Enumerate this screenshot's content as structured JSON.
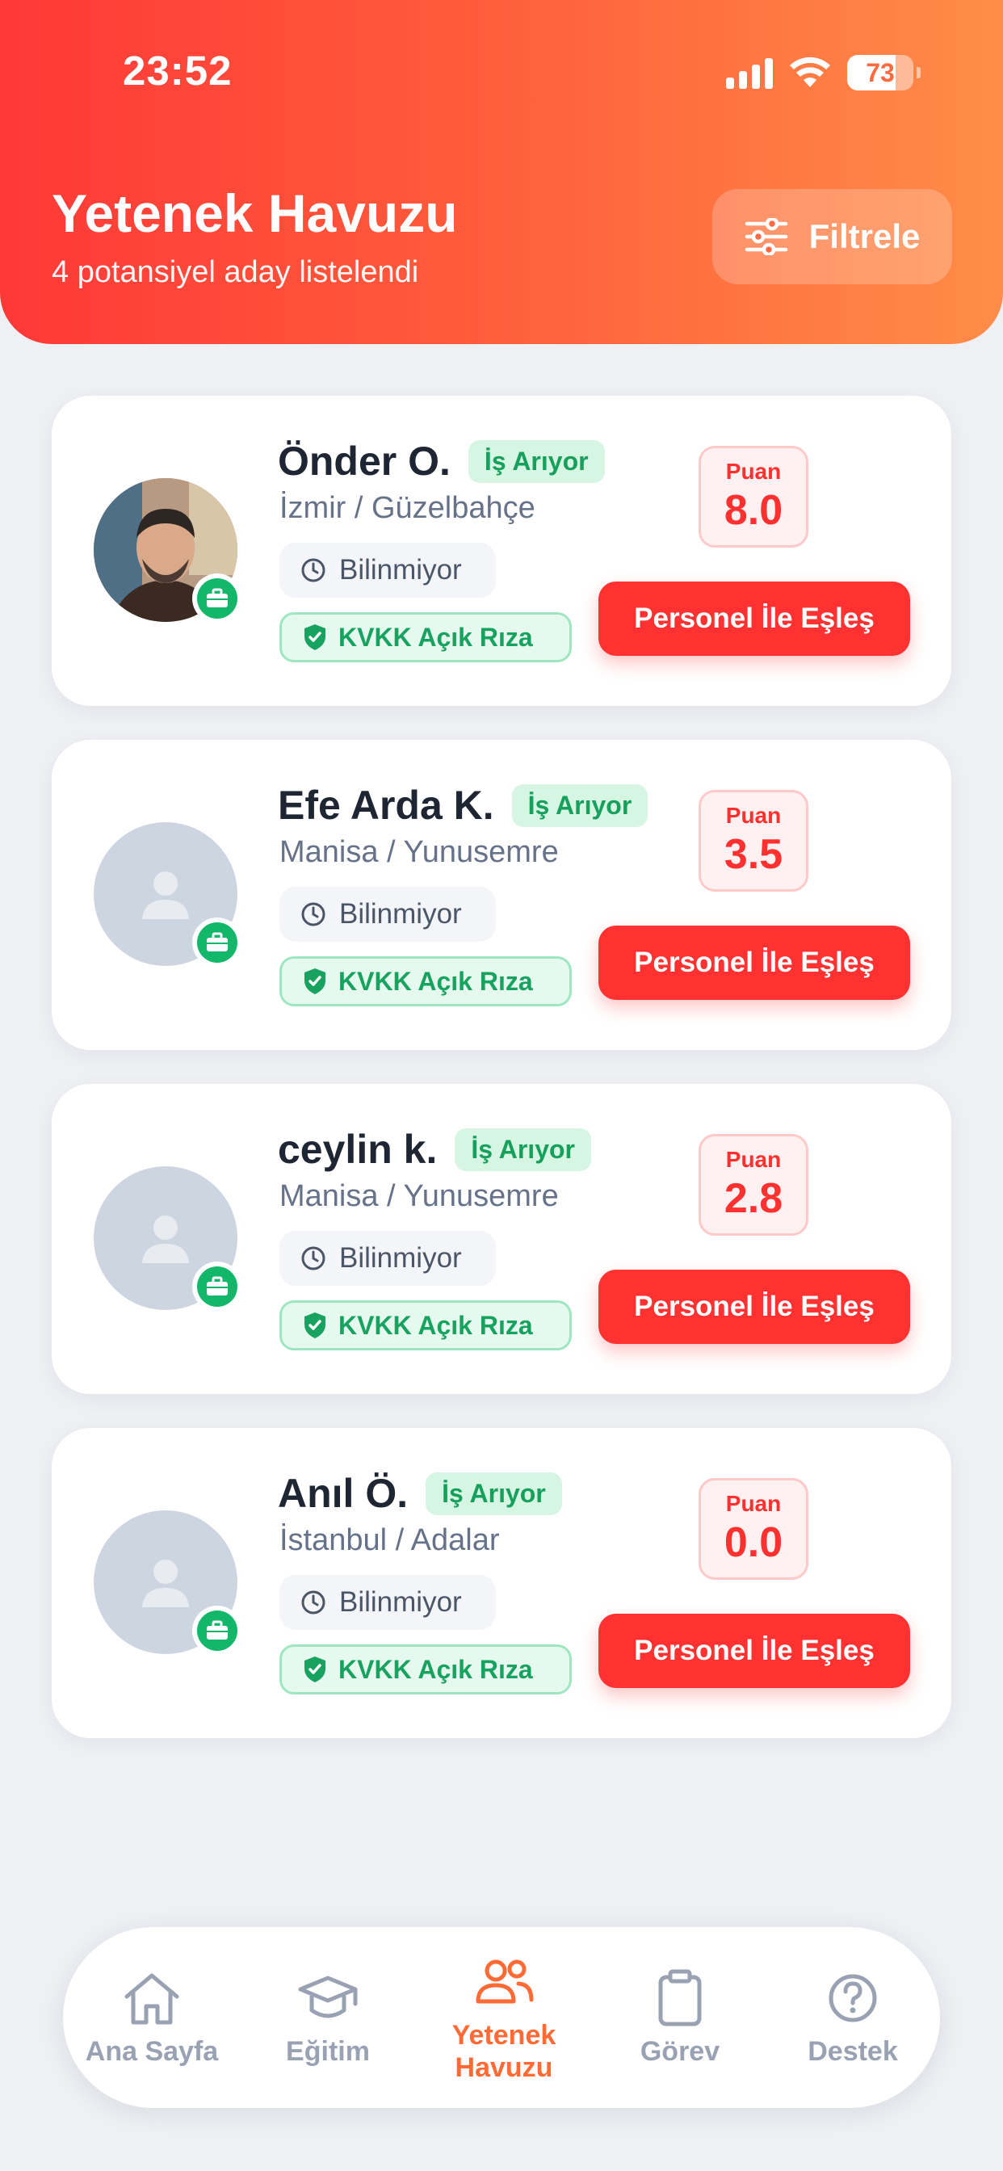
{
  "status_bar": {
    "time": "23:52",
    "battery": "73"
  },
  "header": {
    "title": "Yetenek Havuzu",
    "subtitle": "4 potansiyel aday listelendi",
    "filter_label": "Filtrele"
  },
  "candidates": [
    {
      "name": "Önder O.",
      "status": "İş Arıyor",
      "location": "İzmir / Güzelbahçe",
      "availability": "Bilinmiyor",
      "consent": "KVKK Açık Rıza",
      "score_label": "Puan",
      "score": "8.0",
      "action": "Personel İle Eşleş"
    },
    {
      "name": "Efe Arda K.",
      "status": "İş Arıyor",
      "location": "Manisa / Yunusemre",
      "availability": "Bilinmiyor",
      "consent": "KVKK Açık Rıza",
      "score_label": "Puan",
      "score": "3.5",
      "action": "Personel İle Eşleş"
    },
    {
      "name": "ceylin k.",
      "status": "İş Arıyor",
      "location": "Manisa / Yunusemre",
      "availability": "Bilinmiyor",
      "consent": "KVKK Açık Rıza",
      "score_label": "Puan",
      "score": "2.8",
      "action": "Personel İle Eşleş"
    },
    {
      "name": "Anıl Ö.",
      "status": "İş Arıyor",
      "location": "İstanbul / Adalar",
      "availability": "Bilinmiyor",
      "consent": "KVKK Açık Rıza",
      "score_label": "Puan",
      "score": "0.0",
      "action": "Personel İle Eşleş"
    }
  ],
  "nav": {
    "items": [
      {
        "label": "Ana Sayfa",
        "icon": "home-icon"
      },
      {
        "label": "Eğitim",
        "icon": "graduation-cap-icon"
      },
      {
        "label": "Yetenek Havuzu",
        "icon": "users-icon",
        "active": true
      },
      {
        "label": "Görev",
        "icon": "clipboard-icon"
      },
      {
        "label": "Destek",
        "icon": "help-circle-icon"
      }
    ]
  },
  "colors": {
    "accent": "#ff3131",
    "header_start": "#ff3838",
    "header_end": "#ff8d48",
    "success": "#12b76a",
    "active_nav": "#ff6a35"
  }
}
